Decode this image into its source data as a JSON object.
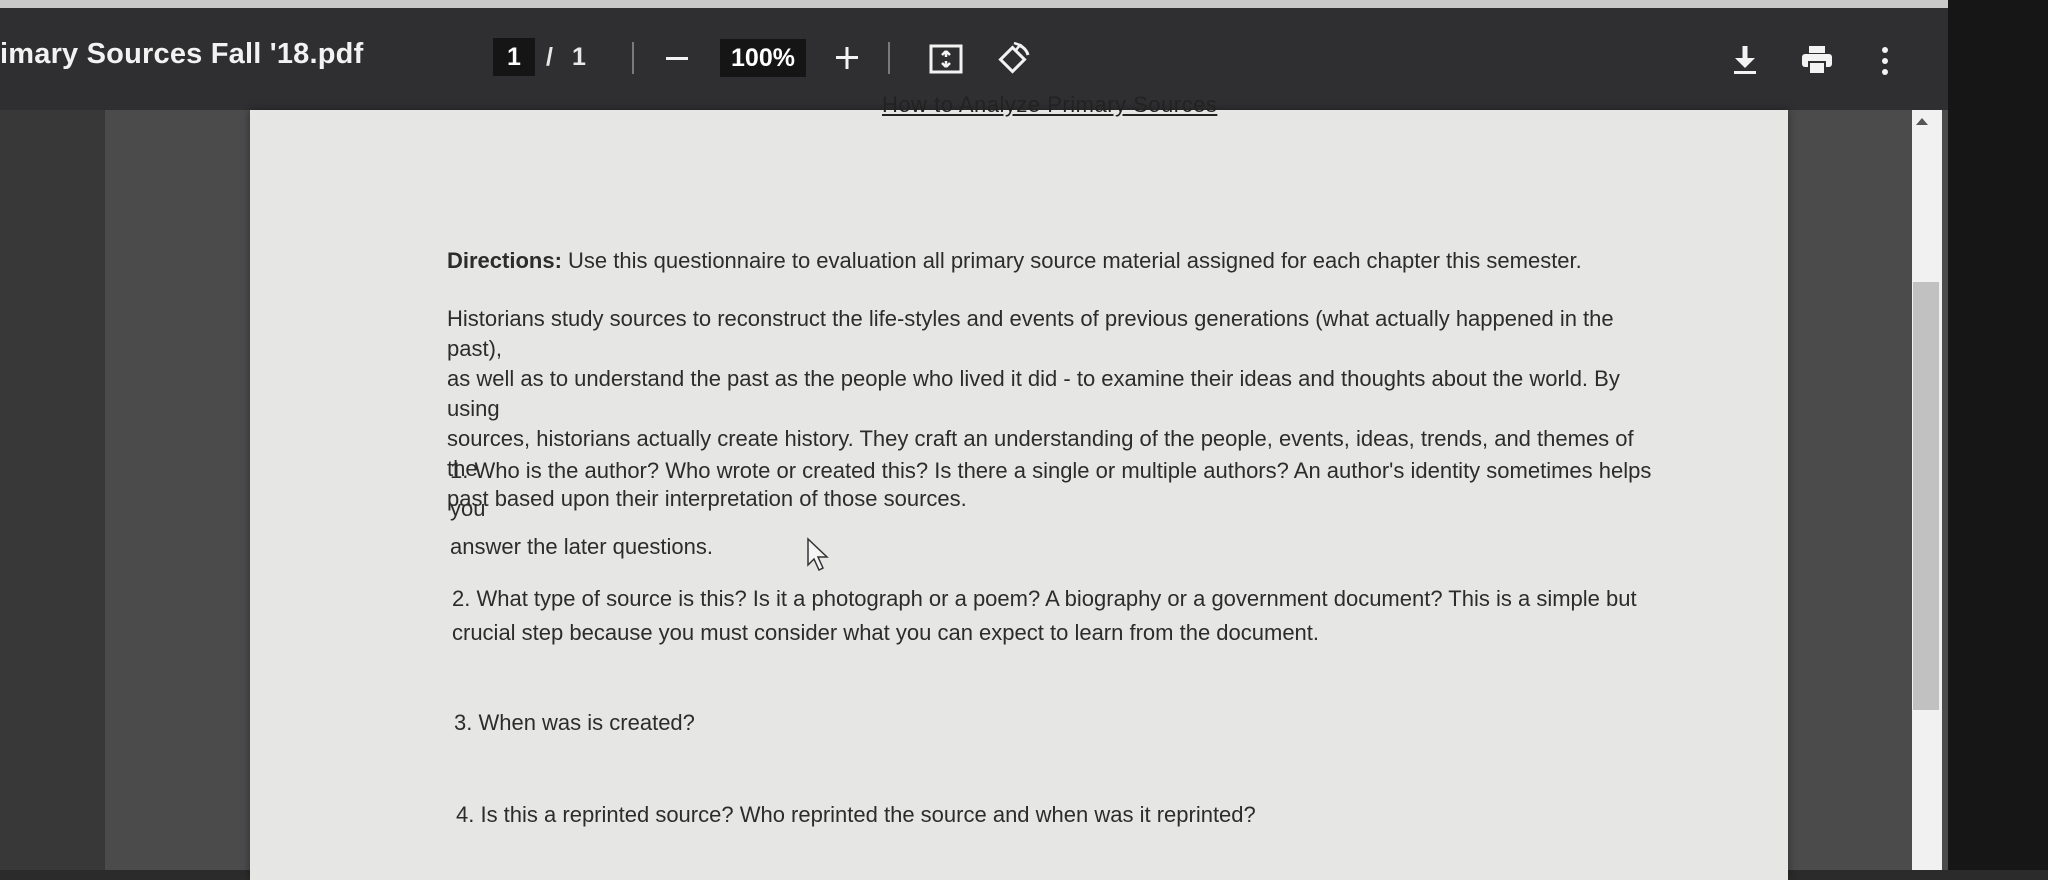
{
  "toolbar": {
    "title": "imary Sources Fall '18.pdf",
    "current_page": "1",
    "page_separator": "/",
    "total_pages": "1",
    "zoom": "100%",
    "icons": [
      "zoom-out-icon",
      "zoom-in-icon",
      "fit-page-icon",
      "rotate-icon",
      "download-icon",
      "print-icon",
      "more-options-icon"
    ]
  },
  "document": {
    "heading": "How to Analyze Primary Sources",
    "directions_label": "Directions:",
    "directions_text": " Use this questionnaire to evaluation all primary source material assigned for each chapter this semester.",
    "intro": [
      "Historians study sources to reconstruct the life-styles and events of previous generations (what actually happened in the past),",
      "as well as to understand the past as the people who lived it did - to examine their ideas and thoughts about the world. By using",
      "sources, historians actually create history. They craft an understanding of the people, events, ideas, trends, and themes of the",
      "past based upon their interpretation of those sources."
    ],
    "q1": [
      "1. Who is the author? Who wrote or created this? Is there a single or multiple authors? An author's identity sometimes helps you",
      "answer the later questions."
    ],
    "q2": [
      "2. What type of source is this? Is it a photograph or a poem? A biography or a government document? This is a simple but",
      "crucial step because you must consider what you can expect to learn from the document."
    ],
    "q3": "3. When was is created?",
    "q4": "4. Is this a reprinted source? Who reprinted the source and when was it reprinted?"
  }
}
